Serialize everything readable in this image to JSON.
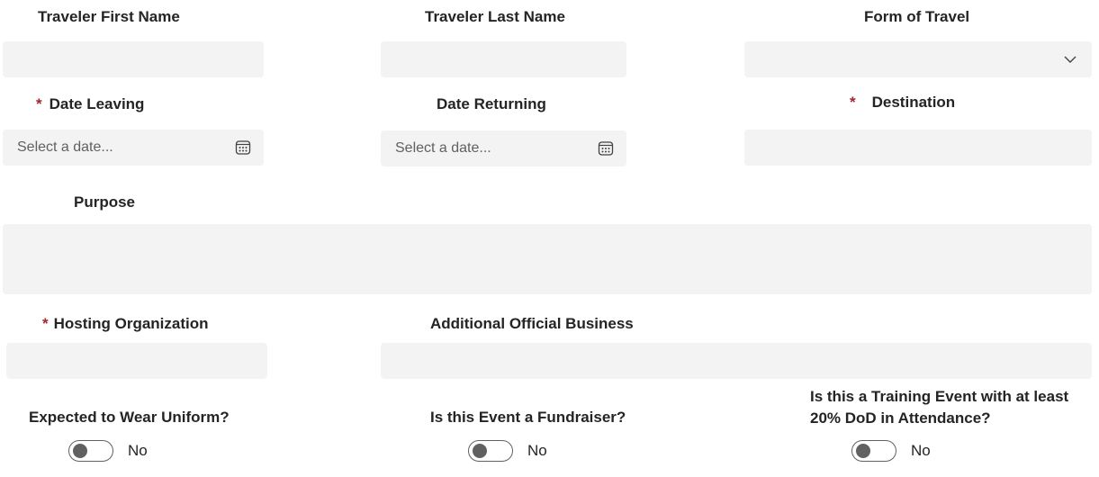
{
  "fields": {
    "first_name": {
      "label": "Traveler First Name",
      "value": ""
    },
    "last_name": {
      "label": "Traveler Last Name",
      "value": ""
    },
    "form_of_travel": {
      "label": "Form of Travel",
      "value": ""
    },
    "date_leaving": {
      "required": "*",
      "label": "Date Leaving",
      "placeholder": "Select a date..."
    },
    "date_returning": {
      "label": "Date Returning",
      "placeholder": "Select a date..."
    },
    "destination": {
      "required": "*",
      "label": "Destination",
      "value": ""
    },
    "purpose": {
      "label": "Purpose",
      "value": ""
    },
    "hosting_org": {
      "required": "*",
      "label": "Hosting Organization",
      "value": ""
    },
    "additional_business": {
      "label": "Additional Official Business",
      "value": ""
    }
  },
  "toggles": {
    "uniform": {
      "label": "Expected to Wear Uniform?",
      "state": "No"
    },
    "fundraiser": {
      "label": "Is this Event a Fundraiser?",
      "state": "No"
    },
    "training": {
      "label": "Is this a Training Event with at least 20% DoD in Attendance?",
      "state": "No"
    }
  },
  "colors": {
    "required": "#a4262c",
    "field_bg": "#f3f3f3",
    "toggle": "#616161"
  },
  "icons": {
    "calendar": "calendar-icon",
    "dropdown": "chevron-down-icon"
  }
}
